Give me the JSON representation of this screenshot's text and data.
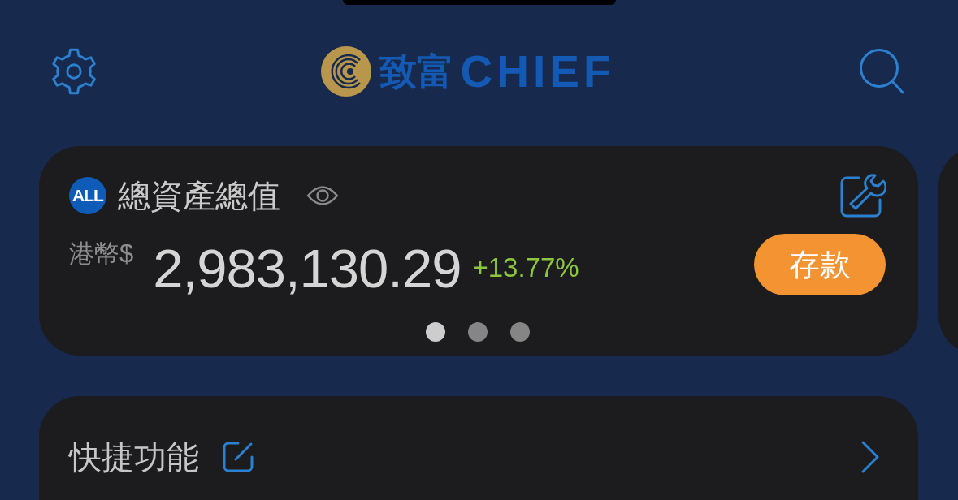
{
  "header": {
    "brand": {
      "chinese": "致富",
      "latin": "CHIEF"
    }
  },
  "asset_card": {
    "badge": "ALL",
    "title": "總資產總值",
    "currency": "港幣$",
    "amount": "2,983,130.29",
    "change": "+13.77%",
    "positive": true,
    "deposit_button": "存款",
    "pages": [
      {
        "selected": true
      },
      {
        "selected": false
      },
      {
        "selected": false
      }
    ]
  },
  "quick_functions": {
    "title": "快捷功能"
  }
}
